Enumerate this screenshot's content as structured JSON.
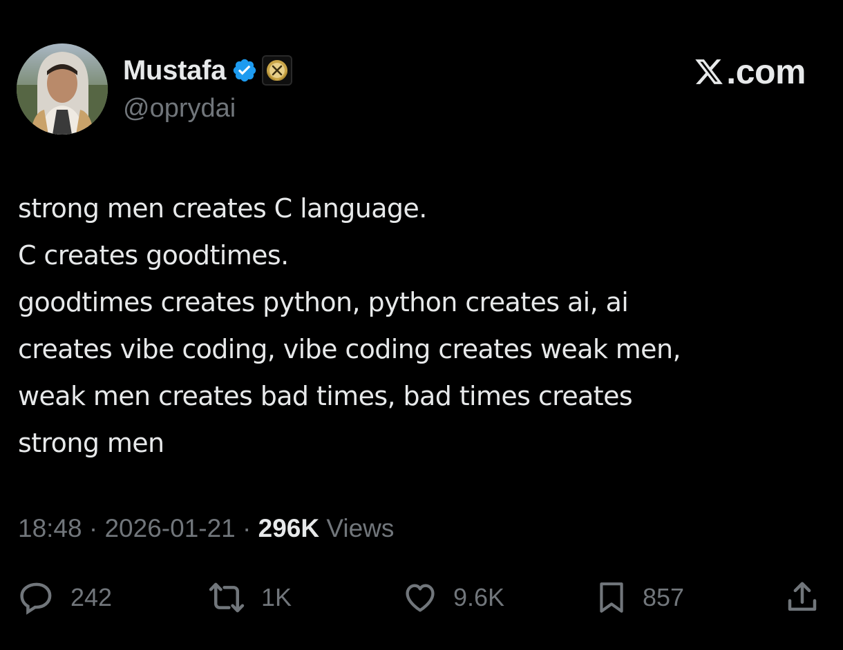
{
  "user": {
    "display_name": "Mustafa",
    "handle": "@oprydai",
    "verified_color": "#1d9bf0"
  },
  "brand": {
    "domain_text": ".com"
  },
  "tweet": {
    "lines": [
      "strong men creates C language.",
      "C creates goodtimes.",
      "goodtimes creates python, python creates ai, ai",
      "creates vibe coding, vibe coding creates weak men,",
      "weak men creates bad times, bad times creates",
      "strong men"
    ]
  },
  "meta": {
    "time": "18:48",
    "date": "2026-01-21",
    "separator": "·",
    "views_count": "296K",
    "views_label": "Views"
  },
  "actions": {
    "reply_count": "242",
    "retweet_count": "1K",
    "like_count": "9.6K",
    "bookmark_count": "857"
  },
  "colors": {
    "background": "#000000",
    "text_primary": "#e7e9ea",
    "text_secondary": "#71767b"
  },
  "icons": [
    "verified-badge-icon",
    "affiliate-x-badge-icon",
    "x-logo-icon",
    "reply-icon",
    "retweet-icon",
    "like-icon",
    "bookmark-icon",
    "share-icon"
  ]
}
